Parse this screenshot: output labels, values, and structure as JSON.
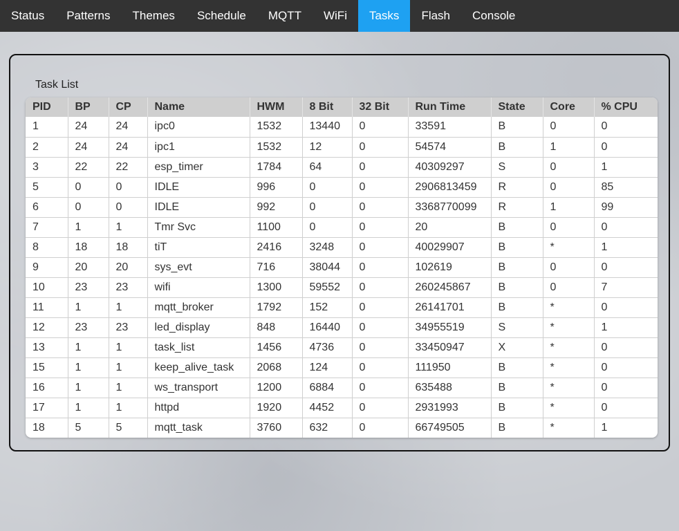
{
  "nav": {
    "items": [
      {
        "label": "Status"
      },
      {
        "label": "Patterns"
      },
      {
        "label": "Themes"
      },
      {
        "label": "Schedule"
      },
      {
        "label": "MQTT"
      },
      {
        "label": "WiFi"
      },
      {
        "label": "Tasks"
      },
      {
        "label": "Flash"
      },
      {
        "label": "Console"
      }
    ],
    "active": "Tasks",
    "active_color": "#1ea1f2",
    "bar_color": "#333333"
  },
  "panel": {
    "title": "Task List"
  },
  "table": {
    "columns": [
      "PID",
      "BP",
      "CP",
      "Name",
      "HWM",
      "8 Bit",
      "32 Bit",
      "Run Time",
      "State",
      "Core",
      "% CPU"
    ],
    "rows": [
      [
        "1",
        "24",
        "24",
        "ipc0",
        "1532",
        "13440",
        "0",
        "33591",
        "B",
        "0",
        "0"
      ],
      [
        "2",
        "24",
        "24",
        "ipc1",
        "1532",
        "12",
        "0",
        "54574",
        "B",
        "1",
        "0"
      ],
      [
        "3",
        "22",
        "22",
        "esp_timer",
        "1784",
        "64",
        "0",
        "40309297",
        "S",
        "0",
        "1"
      ],
      [
        "5",
        "0",
        "0",
        "IDLE",
        "996",
        "0",
        "0",
        "2906813459",
        "R",
        "0",
        "85"
      ],
      [
        "6",
        "0",
        "0",
        "IDLE",
        "992",
        "0",
        "0",
        "3368770099",
        "R",
        "1",
        "99"
      ],
      [
        "7",
        "1",
        "1",
        "Tmr Svc",
        "1100",
        "0",
        "0",
        "20",
        "B",
        "0",
        "0"
      ],
      [
        "8",
        "18",
        "18",
        "tiT",
        "2416",
        "3248",
        "0",
        "40029907",
        "B",
        "*",
        "1"
      ],
      [
        "9",
        "20",
        "20",
        "sys_evt",
        "716",
        "38044",
        "0",
        "102619",
        "B",
        "0",
        "0"
      ],
      [
        "10",
        "23",
        "23",
        "wifi",
        "1300",
        "59552",
        "0",
        "260245867",
        "B",
        "0",
        "7"
      ],
      [
        "11",
        "1",
        "1",
        "mqtt_broker",
        "1792",
        "152",
        "0",
        "26141701",
        "B",
        "*",
        "0"
      ],
      [
        "12",
        "23",
        "23",
        "led_display",
        "848",
        "16440",
        "0",
        "34955519",
        "S",
        "*",
        "1"
      ],
      [
        "13",
        "1",
        "1",
        "task_list",
        "1456",
        "4736",
        "0",
        "33450947",
        "X",
        "*",
        "0"
      ],
      [
        "15",
        "1",
        "1",
        "keep_alive_task",
        "2068",
        "124",
        "0",
        "111950",
        "B",
        "*",
        "0"
      ],
      [
        "16",
        "1",
        "1",
        "ws_transport",
        "1200",
        "6884",
        "0",
        "635488",
        "B",
        "*",
        "0"
      ],
      [
        "17",
        "1",
        "1",
        "httpd",
        "1920",
        "4452",
        "0",
        "2931993",
        "B",
        "*",
        "0"
      ],
      [
        "18",
        "5",
        "5",
        "mqtt_task",
        "3760",
        "632",
        "0",
        "66749505",
        "B",
        "*",
        "1"
      ]
    ]
  }
}
